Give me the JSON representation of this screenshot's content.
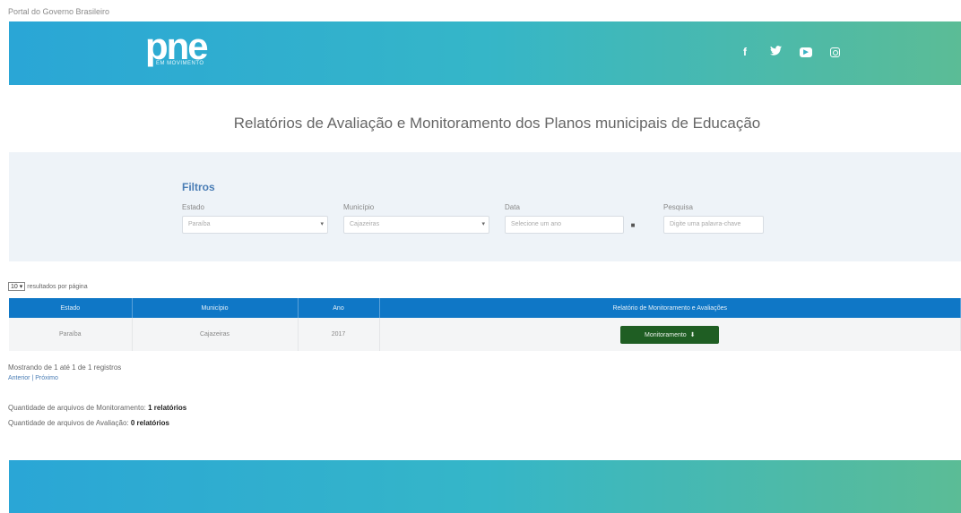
{
  "gov_bar": {
    "link": "Portal do Governo Brasileiro"
  },
  "header": {
    "logo_text": "pne",
    "logo_sub": "EM MOVIMENTO",
    "social": {
      "facebook": "f",
      "twitter": "🐦",
      "youtube": "▶",
      "instagram": "ig"
    }
  },
  "page_title": "Relatórios de Avaliação e Monitoramento dos Planos municipais de Educação",
  "filters": {
    "title": "Filtros",
    "estado": {
      "label": "Estado",
      "value": "Paraíba"
    },
    "municipio": {
      "label": "Município",
      "value": "Cajazeiras"
    },
    "data": {
      "label": "Data",
      "placeholder": "Selecione um ano"
    },
    "pesquisa": {
      "label": "Pesquisa",
      "placeholder": "Digite uma palavra-chave"
    }
  },
  "per_page": {
    "value": "10",
    "label": "resultados por página"
  },
  "table": {
    "columns": [
      "Estado",
      "Município",
      "Ano",
      "Relatório de Monitoramento e Avaliações"
    ],
    "rows": [
      {
        "estado": "Paraíba",
        "municipio": "Cajazeiras",
        "ano": "2017",
        "action": "Monitoramento"
      }
    ]
  },
  "summary": {
    "showing": "Mostrando de 1 até 1 de 1 registros",
    "pager": "Anterior | Próximo",
    "monitoramento_label": "Quantidade de arquivos de Monitoramento:",
    "monitoramento_value": "1 relatórios",
    "avaliacao_label": "Quantidade de arquivos de Avaliação:",
    "avaliacao_value": "0 relatórios"
  },
  "colors": {
    "header_start": "#2aa6d6",
    "header_end": "#5bbc96",
    "table_header": "#0f77c6",
    "button": "#1f5e23"
  }
}
